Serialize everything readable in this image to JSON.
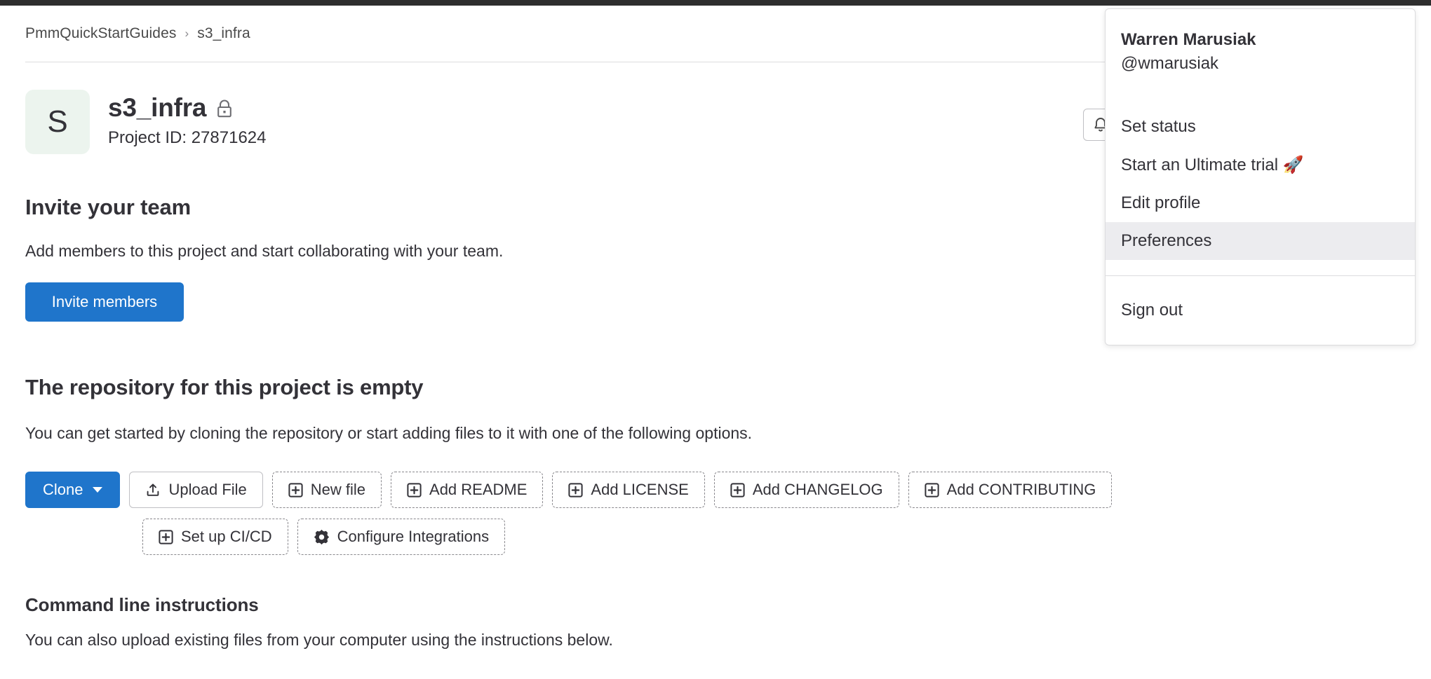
{
  "breadcrumb": {
    "group": "PmmQuickStartGuides",
    "separator": "›",
    "project": "s3_infra"
  },
  "project": {
    "avatar_letter": "S",
    "avatar_bg": "#ecf4ee",
    "name": "s3_infra",
    "visibility_icon": "lock-icon",
    "project_id_label": "Project ID: 27871624"
  },
  "header_actions": {
    "notification_icon": "bell-icon"
  },
  "invite": {
    "heading": "Invite your team",
    "description": "Add members to this project and start collaborating with your team.",
    "button_label": "Invite members"
  },
  "empty_repo": {
    "heading": "The repository for this project is empty",
    "description": "You can get started by cloning the repository or start adding files to it with one of the following options.",
    "actions_row_1": [
      {
        "label": "Clone",
        "icon": "chevron-down-icon",
        "style": "solid-blue"
      },
      {
        "label": "Upload File",
        "icon": "upload-icon",
        "style": "outline"
      },
      {
        "label": "New file",
        "icon": "plus-square-icon",
        "style": "dashed"
      },
      {
        "label": "Add README",
        "icon": "plus-square-icon",
        "style": "dashed"
      },
      {
        "label": "Add LICENSE",
        "icon": "plus-square-icon",
        "style": "dashed"
      },
      {
        "label": "Add CHANGELOG",
        "icon": "plus-square-icon",
        "style": "dashed"
      },
      {
        "label": "Add CONTRIBUTING",
        "icon": "plus-square-icon",
        "style": "dashed"
      }
    ],
    "actions_row_2": [
      {
        "label": "Set up CI/CD",
        "icon": "plus-square-icon",
        "style": "dashed"
      },
      {
        "label": "Configure Integrations",
        "icon": "gear-icon",
        "style": "dashed"
      }
    ]
  },
  "command_line": {
    "heading": "Command line instructions",
    "description": "You can also upload existing files from your computer using the instructions below."
  },
  "user_menu": {
    "name": "Warren Marusiak",
    "handle": "@wmarusiak",
    "items": [
      {
        "label": "Set status",
        "active": false
      },
      {
        "label": "Start an Ultimate trial 🚀",
        "active": false
      },
      {
        "label": "Edit profile",
        "active": false
      },
      {
        "label": "Preferences",
        "active": true
      }
    ],
    "signout_label": "Sign out"
  },
  "colors": {
    "accent_blue": "#1f75cb",
    "topbar_dark": "#2e2e2e",
    "text": "#333238",
    "border": "#dcdcde",
    "hover_bg": "#ececef"
  }
}
